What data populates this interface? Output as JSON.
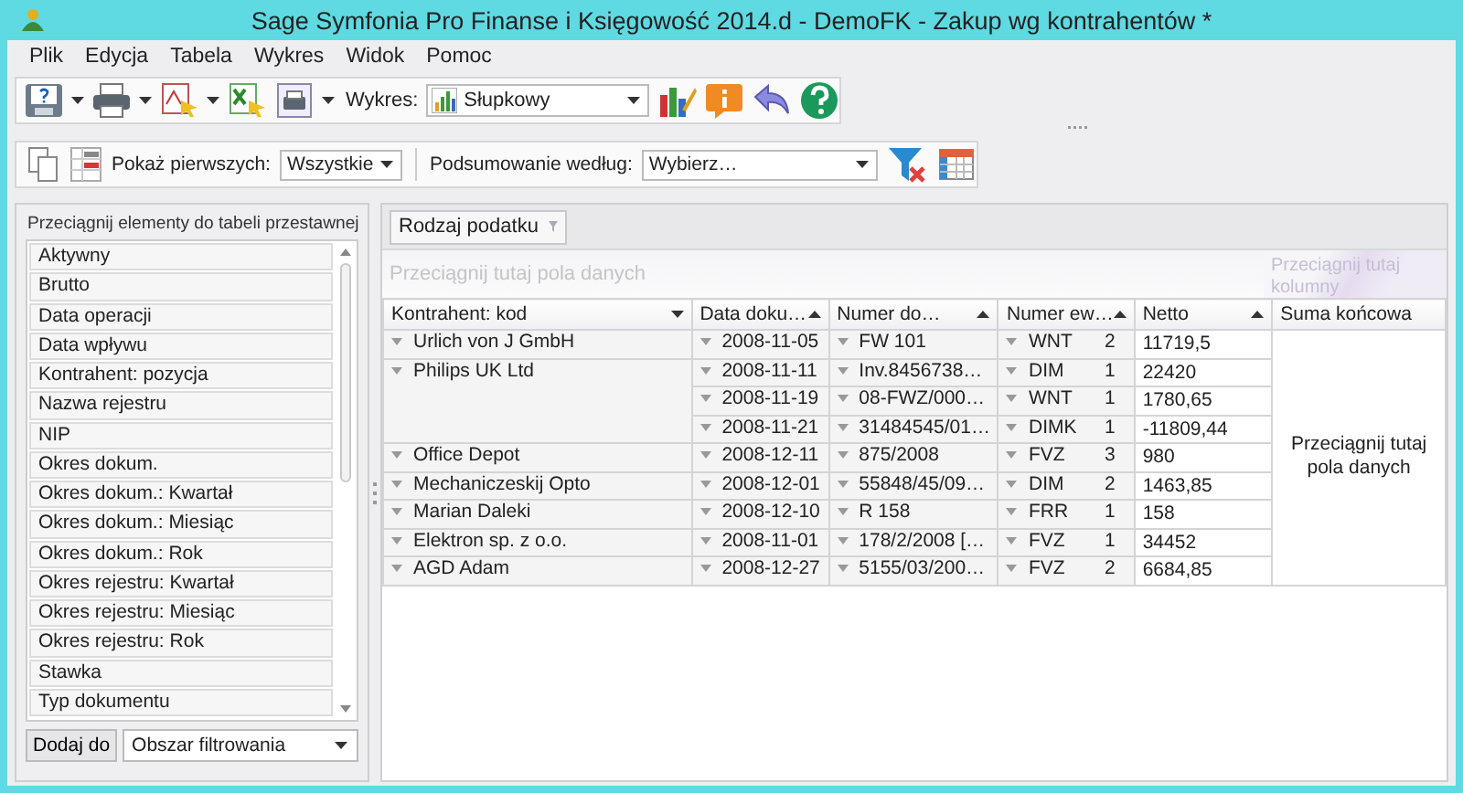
{
  "window": {
    "title": "Sage Symfonia Pro Finanse i Księgowość 2014.d - DemoFK - Zakup wg kontrahentów *"
  },
  "menu": [
    "Plik",
    "Edycja",
    "Tabela",
    "Wykres",
    "Widok",
    "Pomoc"
  ],
  "toolbar": {
    "chart_label": "Wykres:",
    "chart_type": "Słupkowy"
  },
  "pivot_toolbar": {
    "show_first_label": "Pokaż pierwszych:",
    "show_first_value": "Wszystkie",
    "summary_label": "Podsumowanie według:",
    "summary_value": "Wybierz…"
  },
  "field_list": {
    "title": "Przeciągnij elementy do tabeli przestawnej",
    "items": [
      "Aktywny",
      "Brutto",
      "Data operacji",
      "Data wpływu",
      "Kontrahent: pozycja",
      "Nazwa rejestru",
      "NIP",
      "Okres dokum.",
      "Okres dokum.: Kwartał",
      "Okres dokum.: Miesiąc",
      "Okres dokum.: Rok",
      "Okres rejestru: Kwartał",
      "Okres rejestru: Miesiąc",
      "Okres rejestru: Rok",
      "Stawka",
      "Typ dokumentu"
    ],
    "add_button": "Dodaj do",
    "area": "Obszar filtrowania"
  },
  "pivot": {
    "filter_fields": [
      "Rodzaj podatku"
    ],
    "data_area_hint": "Przeciągnij tutaj pola danych",
    "column_area_hint": "Przeciągnij tutaj kolumny",
    "row_headers": [
      {
        "label": "Kontrahent: kod",
        "kind": "dropdown"
      },
      {
        "label": "Data doku…",
        "kind": "sorted"
      },
      {
        "label": "Numer do…",
        "kind": "sorted"
      },
      {
        "label": "Numer ew…",
        "kind": "sorted"
      },
      {
        "label": "Netto",
        "kind": "sorted"
      }
    ],
    "grand_total": "Suma końcowa",
    "grand_total_hint": "Przeciągnij tutaj pola danych",
    "rows": [
      {
        "contractor": "Urlich von J GmbH",
        "entries": [
          {
            "date": "2008-11-05",
            "number": "FW 101",
            "register": "WNT",
            "count": "2",
            "net": "11719,5"
          }
        ]
      },
      {
        "contractor": "Philips UK Ltd",
        "entries": [
          {
            "date": "2008-11-11",
            "number": "Inv.8456738…",
            "register": "DIM",
            "count": "1",
            "net": "22420"
          },
          {
            "date": "2008-11-19",
            "number": "08-FWZ/000…",
            "register": "WNT",
            "count": "1",
            "net": "1780,65"
          },
          {
            "date": "2008-11-21",
            "number": "31484545/01…",
            "register": "DIMK",
            "count": "1",
            "net": "-11809,44"
          }
        ]
      },
      {
        "contractor": "Office Depot",
        "entries": [
          {
            "date": "2008-12-11",
            "number": "875/2008",
            "register": "FVZ",
            "count": "3",
            "net": "980"
          }
        ]
      },
      {
        "contractor": "Mechaniczeskij Opto",
        "entries": [
          {
            "date": "2008-12-01",
            "number": "55848/45/09…",
            "register": "DIM",
            "count": "2",
            "net": "1463,85"
          }
        ]
      },
      {
        "contractor": "Marian Daleki",
        "entries": [
          {
            "date": "2008-12-10",
            "number": "R 158",
            "register": "FRR",
            "count": "1",
            "net": "158"
          }
        ]
      },
      {
        "contractor": "Elektron sp. z o.o.",
        "entries": [
          {
            "date": "2008-11-01",
            "number": "178/2/2008 […",
            "register": "FVZ",
            "count": "1",
            "net": "34452"
          }
        ]
      },
      {
        "contractor": "AGD Adam",
        "entries": [
          {
            "date": "2008-12-27",
            "number": "5155/03/200…",
            "register": "FVZ",
            "count": "2",
            "net": "6684,85"
          }
        ]
      }
    ]
  }
}
